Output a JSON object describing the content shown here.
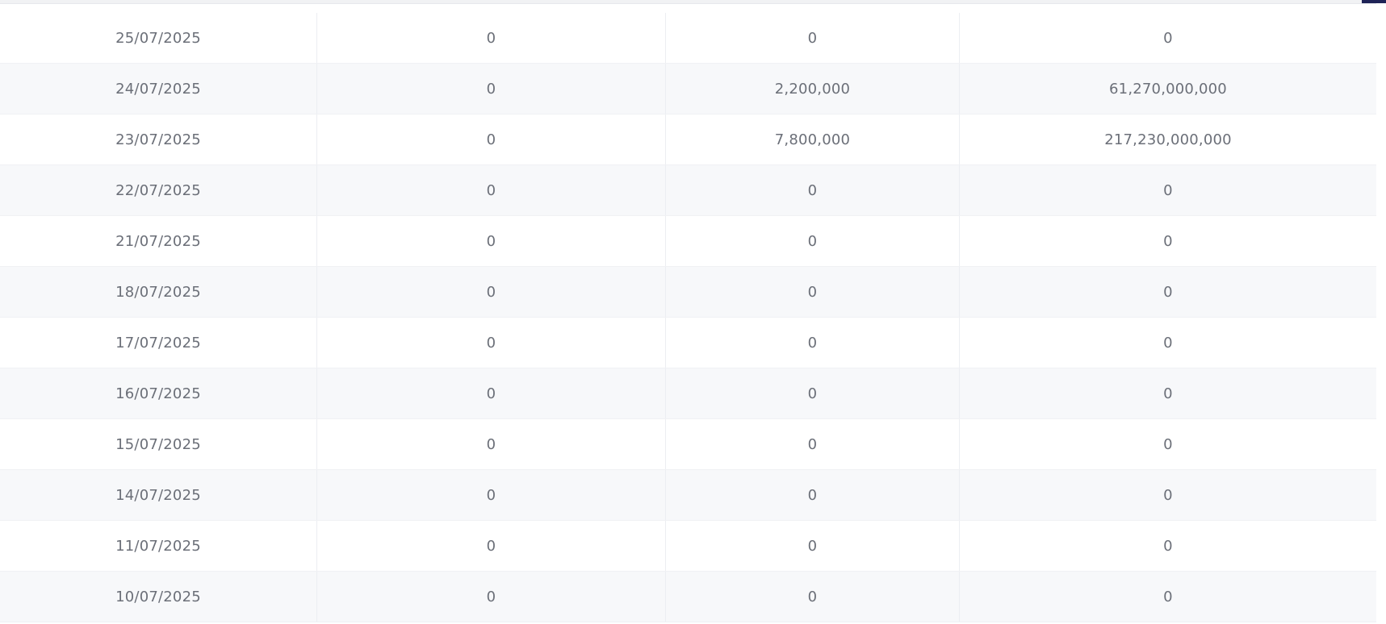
{
  "colors": {
    "row_odd": "#ffffff",
    "row_even": "#f7f8fa",
    "text": "#6b6f78",
    "scroll_accent": "#1f2357"
  },
  "table": {
    "rows": [
      {
        "date": "25/07/2025",
        "col2": "0",
        "col3": "0",
        "col4": "0"
      },
      {
        "date": "24/07/2025",
        "col2": "0",
        "col3": "2,200,000",
        "col4": "61,270,000,000"
      },
      {
        "date": "23/07/2025",
        "col2": "0",
        "col3": "7,800,000",
        "col4": "217,230,000,000"
      },
      {
        "date": "22/07/2025",
        "col2": "0",
        "col3": "0",
        "col4": "0"
      },
      {
        "date": "21/07/2025",
        "col2": "0",
        "col3": "0",
        "col4": "0"
      },
      {
        "date": "18/07/2025",
        "col2": "0",
        "col3": "0",
        "col4": "0"
      },
      {
        "date": "17/07/2025",
        "col2": "0",
        "col3": "0",
        "col4": "0"
      },
      {
        "date": "16/07/2025",
        "col2": "0",
        "col3": "0",
        "col4": "0"
      },
      {
        "date": "15/07/2025",
        "col2": "0",
        "col3": "0",
        "col4": "0"
      },
      {
        "date": "14/07/2025",
        "col2": "0",
        "col3": "0",
        "col4": "0"
      },
      {
        "date": "11/07/2025",
        "col2": "0",
        "col3": "0",
        "col4": "0"
      },
      {
        "date": "10/07/2025",
        "col2": "0",
        "col3": "0",
        "col4": "0"
      }
    ]
  }
}
